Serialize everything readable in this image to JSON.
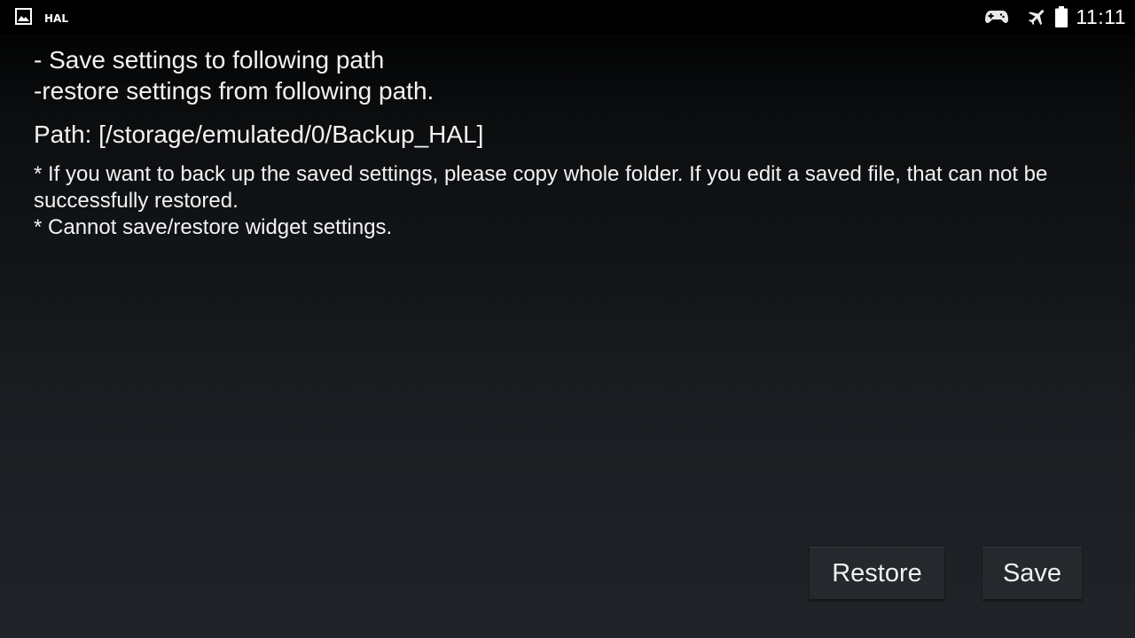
{
  "status_bar": {
    "notification_label": "HAL",
    "time": "11:11",
    "icons": [
      "image-icon",
      "gamepad-icon",
      "airplane-mode-icon",
      "battery-icon"
    ]
  },
  "content": {
    "line1": "- Save settings to following path",
    "line2": "-restore settings from following path.",
    "path_text": "Path: [/storage/emulated/0/Backup_HAL]",
    "note1": "* If you want to back up the saved settings, please copy whole folder. If you edit a saved file, that can not be successfully restored.",
    "note2": "* Cannot save/restore widget settings."
  },
  "buttons": {
    "restore_label": "Restore",
    "save_label": "Save"
  },
  "colors": {
    "background_top": "#000000",
    "background_bottom": "#202328",
    "button_bg": "#25282c",
    "text": "#f2f2f2"
  }
}
